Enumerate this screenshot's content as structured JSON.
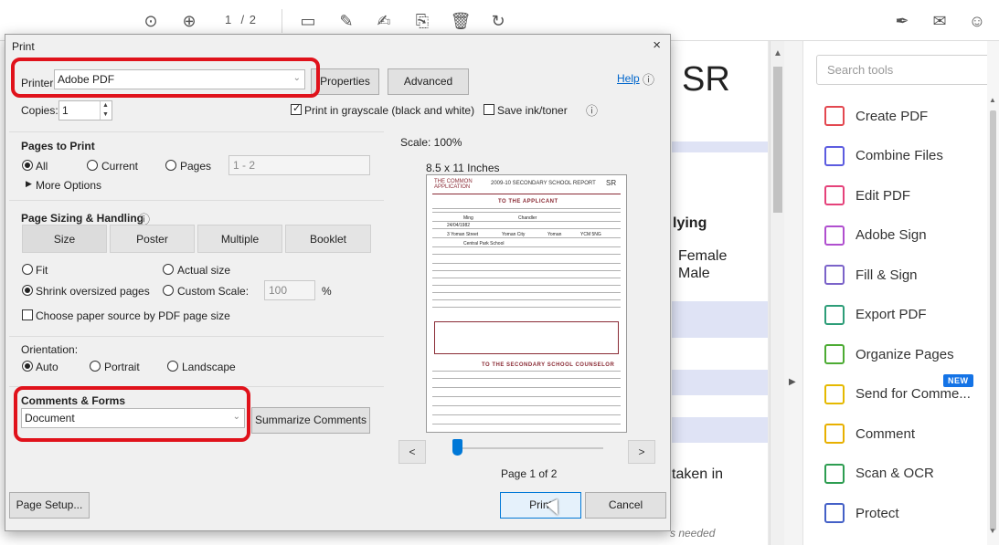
{
  "toolbar": {
    "page_current": "1",
    "page_total": "/ 2"
  },
  "document": {
    "heading": "SR",
    "text_lying": "lying",
    "text_female": "Female",
    "text_male": "Male",
    "text_taken": "taken in",
    "text_needed": "s needed"
  },
  "tools_panel": {
    "search_placeholder": "Search tools",
    "new_badge": "NEW",
    "items": [
      {
        "label": "Create PDF",
        "color": "#e34850"
      },
      {
        "label": "Combine Files",
        "color": "#5c5ce0"
      },
      {
        "label": "Edit PDF",
        "color": "#e5427a"
      },
      {
        "label": "Adobe Sign",
        "color": "#b04fcf"
      },
      {
        "label": "Fill & Sign",
        "color": "#7b63c9"
      },
      {
        "label": "Export PDF",
        "color": "#2d9d78"
      },
      {
        "label": "Organize Pages",
        "color": "#4cab33"
      },
      {
        "label": "Send for Comme...",
        "color": "#e5b900"
      },
      {
        "label": "Comment",
        "color": "#e8b000"
      },
      {
        "label": "Scan & OCR",
        "color": "#2d9d51"
      },
      {
        "label": "Protect",
        "color": "#4460c7"
      }
    ]
  },
  "print_dialog": {
    "title": "Print",
    "close": "×",
    "printer_label": "Printer:",
    "printer_value": "Adobe PDF",
    "properties_button": "Properties",
    "advanced_button": "Advanced",
    "help_link": "Help",
    "help_icon": "ⓘ",
    "copies_label": "Copies:",
    "copies_value": "1",
    "grayscale_label": "Print in grayscale (black and white)",
    "save_ink_label": "Save ink/toner",
    "pages_to_print": {
      "heading": "Pages to Print",
      "all": "All",
      "current": "Current",
      "pages": "Pages",
      "pages_range": "1 - 2",
      "more_options": "More Options"
    },
    "sizing": {
      "heading": "Page Sizing & Handling",
      "tabs": [
        "Size",
        "Poster",
        "Multiple",
        "Booklet"
      ],
      "fit": "Fit",
      "actual_size": "Actual size",
      "shrink": "Shrink oversized pages",
      "custom_scale": "Custom Scale:",
      "custom_scale_value": "100",
      "percent": "%",
      "paper_source": "Choose paper source by PDF page size"
    },
    "orientation": {
      "heading": "Orientation:",
      "auto": "Auto",
      "portrait": "Portrait",
      "landscape": "Landscape"
    },
    "comments_forms": {
      "heading": "Comments & Forms",
      "value": "Document",
      "summarize_button": "Summarize Comments"
    },
    "preview": {
      "scale": "Scale: 100%",
      "paper_size": "8.5 x 11 Inches",
      "page_indicator": "Page 1 of 2",
      "prev": "<",
      "next": ">",
      "slider_position": 0.02,
      "doc_logo_top": "THE COMMON",
      "doc_logo_bottom": "APPLICATION",
      "doc_title": "2009-10 SECONDARY SCHOOL REPORT",
      "doc_title_code": "SR",
      "doc_section_applicant": "TO THE APPLICANT",
      "doc_section_counselor": "TO THE SECONDARY SCHOOL COUNSELOR",
      "doc_name_1": "Ming",
      "doc_name_2": "Chandler",
      "doc_dob": "24/04/1982",
      "doc_street": "3 Yoman Street",
      "doc_city": "Yoman City",
      "doc_state": "Yoman",
      "doc_zip": "YCM 5NG",
      "doc_school": "Central Park School"
    },
    "page_setup_button": "Page Setup...",
    "print_button": "Print",
    "cancel_button": "Cancel"
  },
  "colors": {
    "highlight": "#e0121b",
    "accent": "#0078d7"
  }
}
